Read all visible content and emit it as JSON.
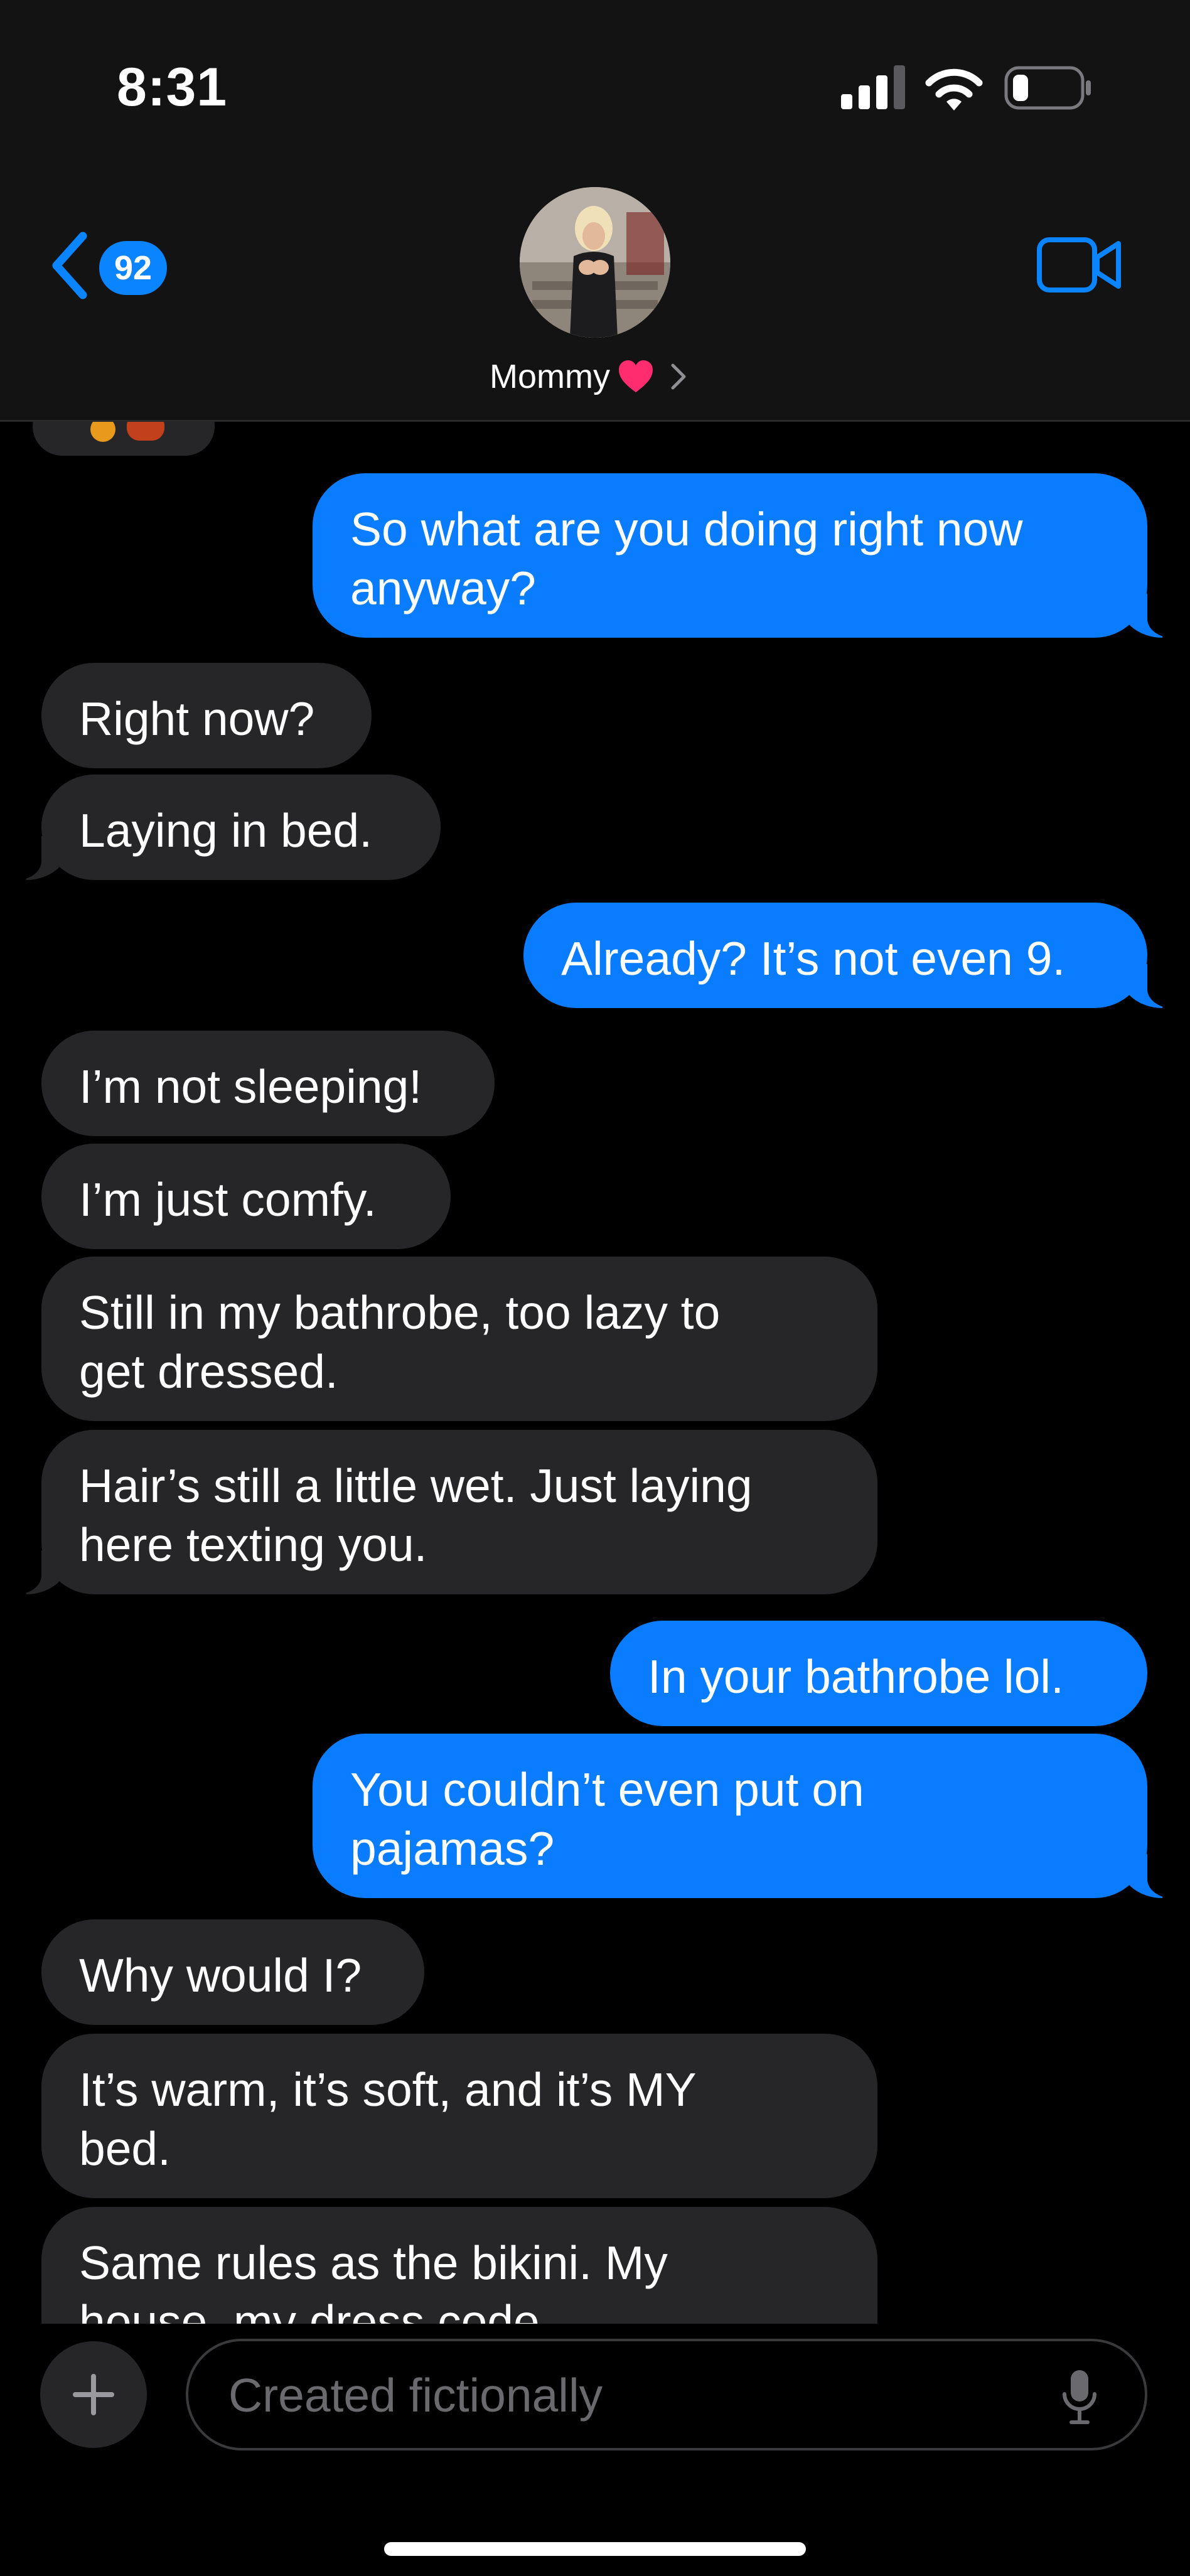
{
  "status_bar": {
    "time": "8:31"
  },
  "header": {
    "back_badge": "92",
    "contact_name": "Mommy"
  },
  "messages": [
    {
      "direction": "out",
      "text": "So what are you doing right now\nanyway?"
    },
    {
      "direction": "in",
      "text": "Right now?"
    },
    {
      "direction": "in",
      "text": "Laying in bed."
    },
    {
      "direction": "out",
      "text": "Already? It’s not even 9."
    },
    {
      "direction": "in",
      "text": "I’m not sleeping!"
    },
    {
      "direction": "in",
      "text": "I’m just comfy."
    },
    {
      "direction": "in",
      "text": "Still in my bathrobe, too lazy to\nget dressed."
    },
    {
      "direction": "in",
      "text": "Hair’s still a little wet. Just laying\nhere texting you."
    },
    {
      "direction": "out",
      "text": "In your bathrobe lol."
    },
    {
      "direction": "out",
      "text": "You couldn’t even put on\npajamas?"
    },
    {
      "direction": "in",
      "text": "Why would I?"
    },
    {
      "direction": "in",
      "text": "It’s warm, it’s soft, and it’s MY\nbed."
    },
    {
      "direction": "in",
      "text": "Same rules as the bikini. My\nhouse, my dress code."
    }
  ],
  "composer": {
    "placeholder": "Created fictionally"
  },
  "colors": {
    "accent": "#0a84ff",
    "outgoing": "#0a7cff",
    "incoming": "#262628",
    "heart": "#ff2d6f"
  }
}
